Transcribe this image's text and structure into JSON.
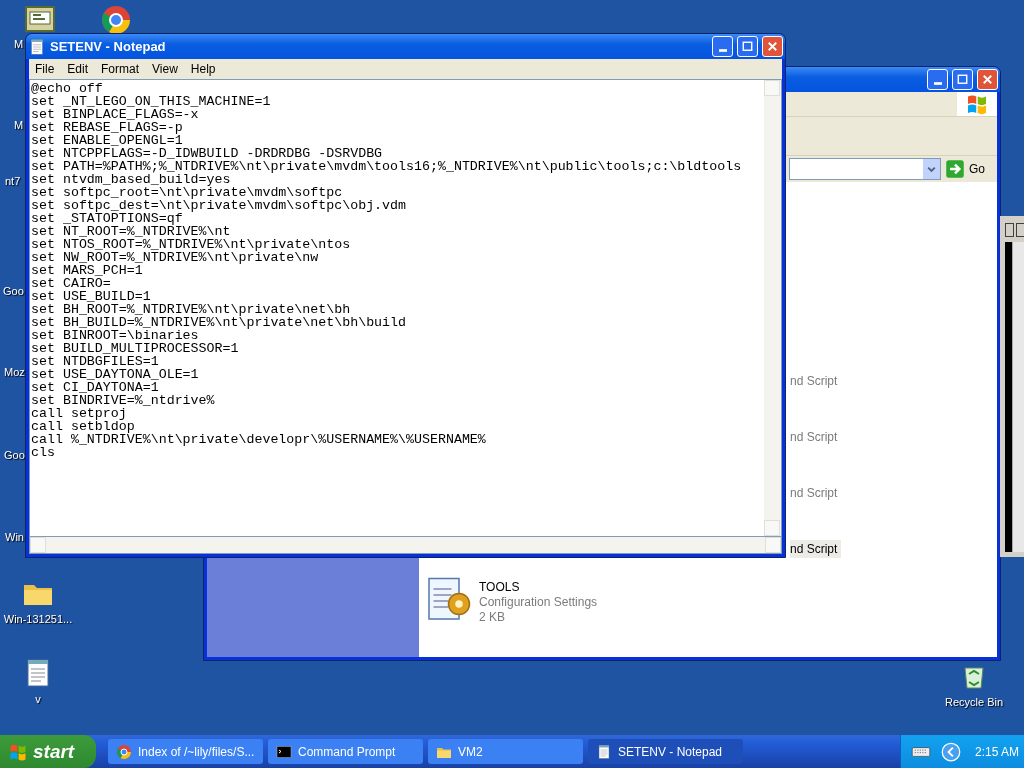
{
  "desktop": {
    "icons": [
      {
        "kind": "console"
      },
      {
        "kind": "browser"
      },
      {
        "kind": "folder",
        "label": "Win-131251..."
      },
      {
        "kind": "document",
        "label": "v"
      },
      {
        "kind": "recycle",
        "label": "Recycle Bin"
      }
    ],
    "covered_labels": [
      "M",
      "M",
      "nt7",
      "Goo",
      "Moz",
      "Goo",
      "Win"
    ]
  },
  "explorer": {
    "go_button": "Go",
    "items": [
      {
        "type_text": "nd Script",
        "selected": false
      },
      {
        "type_text": "nd Script",
        "selected": false
      },
      {
        "type_text": "nd Script",
        "selected": false
      },
      {
        "type_text": "nd Script",
        "selected": true
      }
    ],
    "files": [
      {
        "name": "TOOLS",
        "type": "Configuration Settings",
        "size": "2 KB"
      }
    ]
  },
  "notepad": {
    "title": "SETENV - Notepad",
    "menu": [
      "File",
      "Edit",
      "Format",
      "View",
      "Help"
    ],
    "lines": [
      "@echo off",
      "set _NT_LEGO_ON_THIS_MACHINE=1",
      "set BINPLACE_FLAGS=-x",
      "set REBASE_FLAGS=-p",
      "set ENABLE_OPENGL=1",
      "set NTCPPFLAGS=-D_IDWBUILD -DRDRDBG -DSRVDBG",
      "set PATH=%PATH%;%_NTDRIVE%\\nt\\private\\mvdm\\tools16;%_NTDRIVE%\\nt\\public\\tools;c:\\bldtools",
      "set ntvdm_based_build=yes",
      "set softpc_root=\\nt\\private\\mvdm\\softpc",
      "set softpc_dest=\\nt\\private\\mvdm\\softpc\\obj.vdm",
      "set _STATOPTIONS=qf",
      "set NT_ROOT=%_NTDRIVE%\\nt",
      "set NTOS_ROOT=%_NTDRIVE%\\nt\\private\\ntos",
      "set NW_ROOT=%_NTDRIVE%\\nt\\private\\nw",
      "set MARS_PCH=1",
      "set CAIRO=",
      "set USE_BUILD=1",
      "set BH_ROOT=%_NTDRIVE%\\nt\\private\\net\\bh",
      "set BH_BUILD=%_NTDRIVE%\\nt\\private\\net\\bh\\build",
      "set BINROOT=\\binaries",
      "set BUILD_MULTIPROCESSOR=1",
      "set NTDBGFILES=1",
      "set USE_DAYTONA_OLE=1",
      "set CI_DAYTONA=1",
      "set BINDRIVE=%_ntdrive%",
      "call setproj",
      "call setbldop",
      "call %_NTDRIVE%\\nt\\private\\developr\\%USERNAME%\\%USERNAME%",
      "cls"
    ]
  },
  "taskbar": {
    "start": "start",
    "tasks": [
      {
        "kind": "browser",
        "label": "Index of /~lily/files/S...",
        "selected": false
      },
      {
        "kind": "console",
        "label": "Command Prompt",
        "selected": false
      },
      {
        "kind": "folder",
        "label": "VM2",
        "selected": false
      },
      {
        "kind": "notepad",
        "label": "SETENV - Notepad",
        "selected": true
      }
    ],
    "clock": "2:15 AM"
  }
}
